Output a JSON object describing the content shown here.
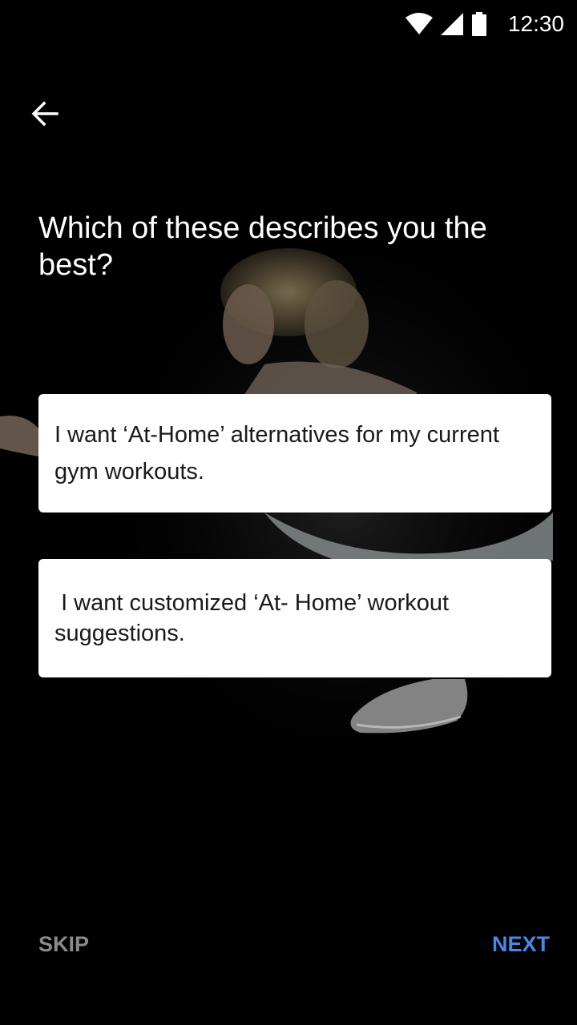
{
  "status_bar": {
    "time": "12:30",
    "icons": [
      "wifi-icon",
      "cellular-signal-icon",
      "battery-icon"
    ]
  },
  "navigation": {
    "back_icon": "arrow-left-icon"
  },
  "question": {
    "text": "Which of these describes you the best?"
  },
  "options": [
    {
      "label": "I want ‘At-Home’ alternatives for my current gym workouts."
    },
    {
      "label": " I want customized ‘At- Home’ workout suggestions."
    }
  ],
  "footer": {
    "skip_label": "SKIP",
    "next_label": "NEXT"
  },
  "colors": {
    "background": "#000000",
    "card": "#ffffff",
    "accent": "#4a86e8",
    "muted": "#8a8a8a"
  }
}
